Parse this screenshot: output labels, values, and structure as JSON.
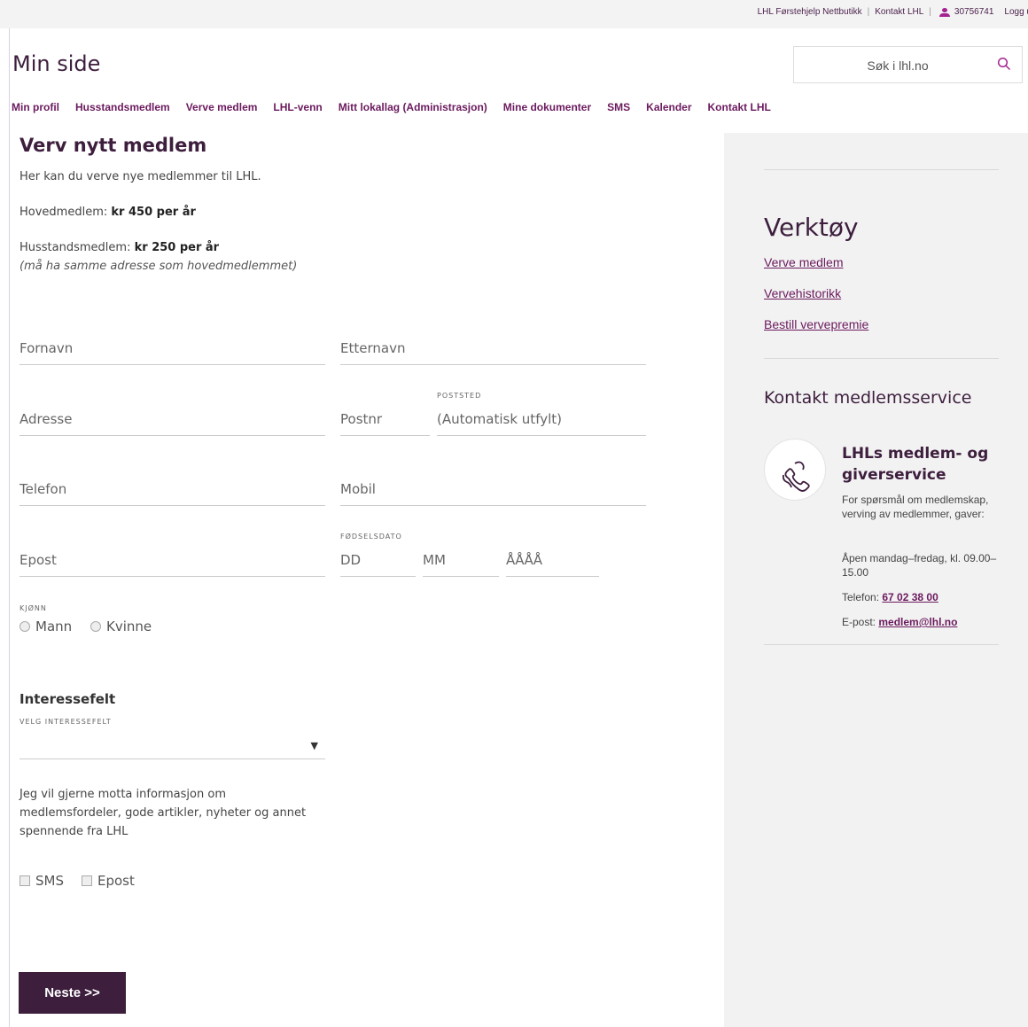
{
  "topbar": {
    "shop_link": "LHL Førstehjelp Nettbutikk",
    "contact_link": "Kontakt LHL",
    "user_number": "30756741",
    "logout": "Logg u"
  },
  "site": {
    "title": "Min side"
  },
  "search": {
    "placeholder": "Søk i lhl.no"
  },
  "nav": [
    "Min profil",
    "Husstandsmedlem",
    "Verve medlem",
    "LHL-venn",
    "Mitt lokallag (Administrasjon)",
    "Mine dokumenter",
    "SMS",
    "Kalender",
    "Kontakt LHL"
  ],
  "main": {
    "heading": "Verv nytt medlem",
    "intro": "Her kan du verve nye medlemmer til LHL.",
    "main_member_label": "Hovedmedlem:",
    "main_member_price": "kr 450 per år",
    "household_label": "Husstandsmedlem:",
    "household_price": "kr 250 per år",
    "household_note": "(må ha samme adresse som hovedmedlemmet)"
  },
  "form": {
    "first_name": "Fornavn",
    "last_name": "Etternavn",
    "address": "Adresse",
    "postal_code": "Postnr",
    "postal_place_label": "POSTSTED",
    "postal_place": "(Automatisk utfylt)",
    "phone": "Telefon",
    "mobile": "Mobil",
    "email": "Epost",
    "birthdate_label": "FØDSELSDATO",
    "day": "DD",
    "month": "MM",
    "year": "ÅÅÅÅ",
    "gender_label": "KJØNN",
    "male": "Mann",
    "female": "Kvinne",
    "interest_title": "Interessefelt",
    "interest_label": "VELG INTERESSEFELT",
    "interest_selected": "",
    "consent_text": "Jeg vil gjerne motta informasjon om medlemsfordeler, gode artikler, nyheter og annet spennende fra LHL",
    "sms": "SMS",
    "epost": "Epost",
    "next_button": "Neste >>"
  },
  "sidebar": {
    "title": "Verktøy",
    "links": [
      "Verve medlem",
      "Vervehistorikk",
      "Bestill vervepremie"
    ],
    "contact_title": "Kontakt medlemsservice",
    "service_title": "LHLs medlem- og giverservice",
    "service_desc": "For spørsmål om medlemskap, verving av medlemmer, gaver:",
    "hours": "Åpen mandag–fredag, kl. 09.00–15.00",
    "phone_label": "Telefon:",
    "phone": "67 02 38 00",
    "email_label": "E-post:",
    "email": "medlem@lhl.no"
  },
  "colors": {
    "brand": "#3d1e3d",
    "accent": "#a3248f",
    "link": "#6b1a5e"
  }
}
